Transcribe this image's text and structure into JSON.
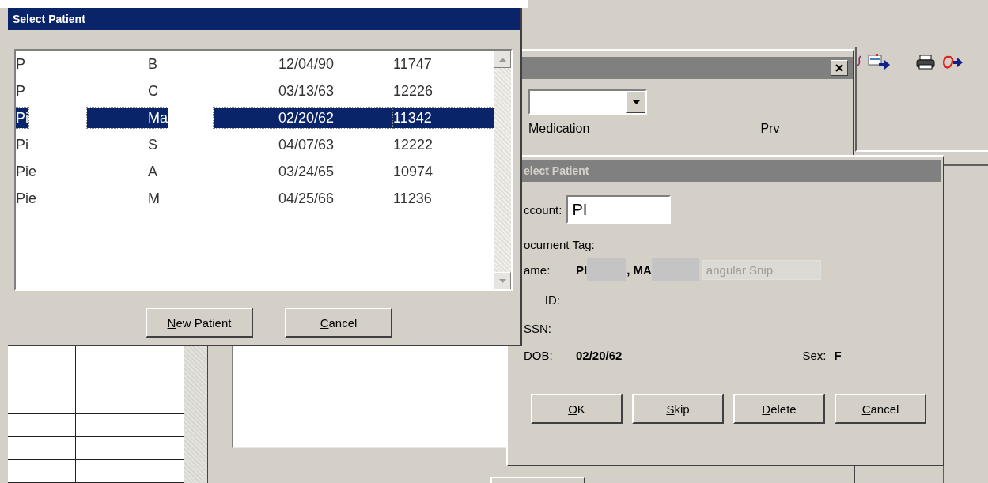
{
  "patient_list_window": {
    "title": "Select Patient",
    "rows": [
      {
        "cells": [
          "P",
          "B",
          "12/04/90",
          "11747"
        ],
        "selected": false
      },
      {
        "cells": [
          "P",
          "C",
          "03/13/63",
          "12226"
        ],
        "selected": false
      },
      {
        "cells": [
          "Pi",
          "Ma",
          "02/20/62",
          "11342"
        ],
        "selected": true
      },
      {
        "cells": [
          "Pi",
          "S",
          "04/07/63",
          "12222"
        ],
        "selected": false
      },
      {
        "cells": [
          "Pie",
          "A",
          "03/24/65",
          "10974"
        ],
        "selected": false
      },
      {
        "cells": [
          "Pie",
          "M",
          "04/25/66",
          "11236"
        ],
        "selected": false
      }
    ],
    "buttons": [
      {
        "key": "N",
        "rest": "ew Patient"
      },
      {
        "key": "C",
        "rest": "ancel"
      }
    ]
  },
  "medication_panel": {
    "columns": [
      "Medication",
      "Prv"
    ]
  },
  "select_patient_dialog": {
    "title": "elect Patient",
    "account": {
      "label": "ccount:",
      "value": "PI"
    },
    "document_tag_label": "ocument Tag:",
    "name": {
      "label": "ame:",
      "last": "PI",
      "first": ", MA",
      "ghost_text": "angular Snip"
    },
    "id_label": "ID:",
    "ssn_label": "SSN:",
    "dob": {
      "label": "DOB:",
      "value": "02/20/62"
    },
    "sex": {
      "label": "Sex:",
      "value": "F"
    },
    "buttons": [
      {
        "key": "O",
        "rest": "K"
      },
      {
        "key": "S",
        "rest": "kip"
      },
      {
        "key": "D",
        "rest": "elete"
      },
      {
        "key": "C",
        "rest": "ancel"
      }
    ]
  }
}
